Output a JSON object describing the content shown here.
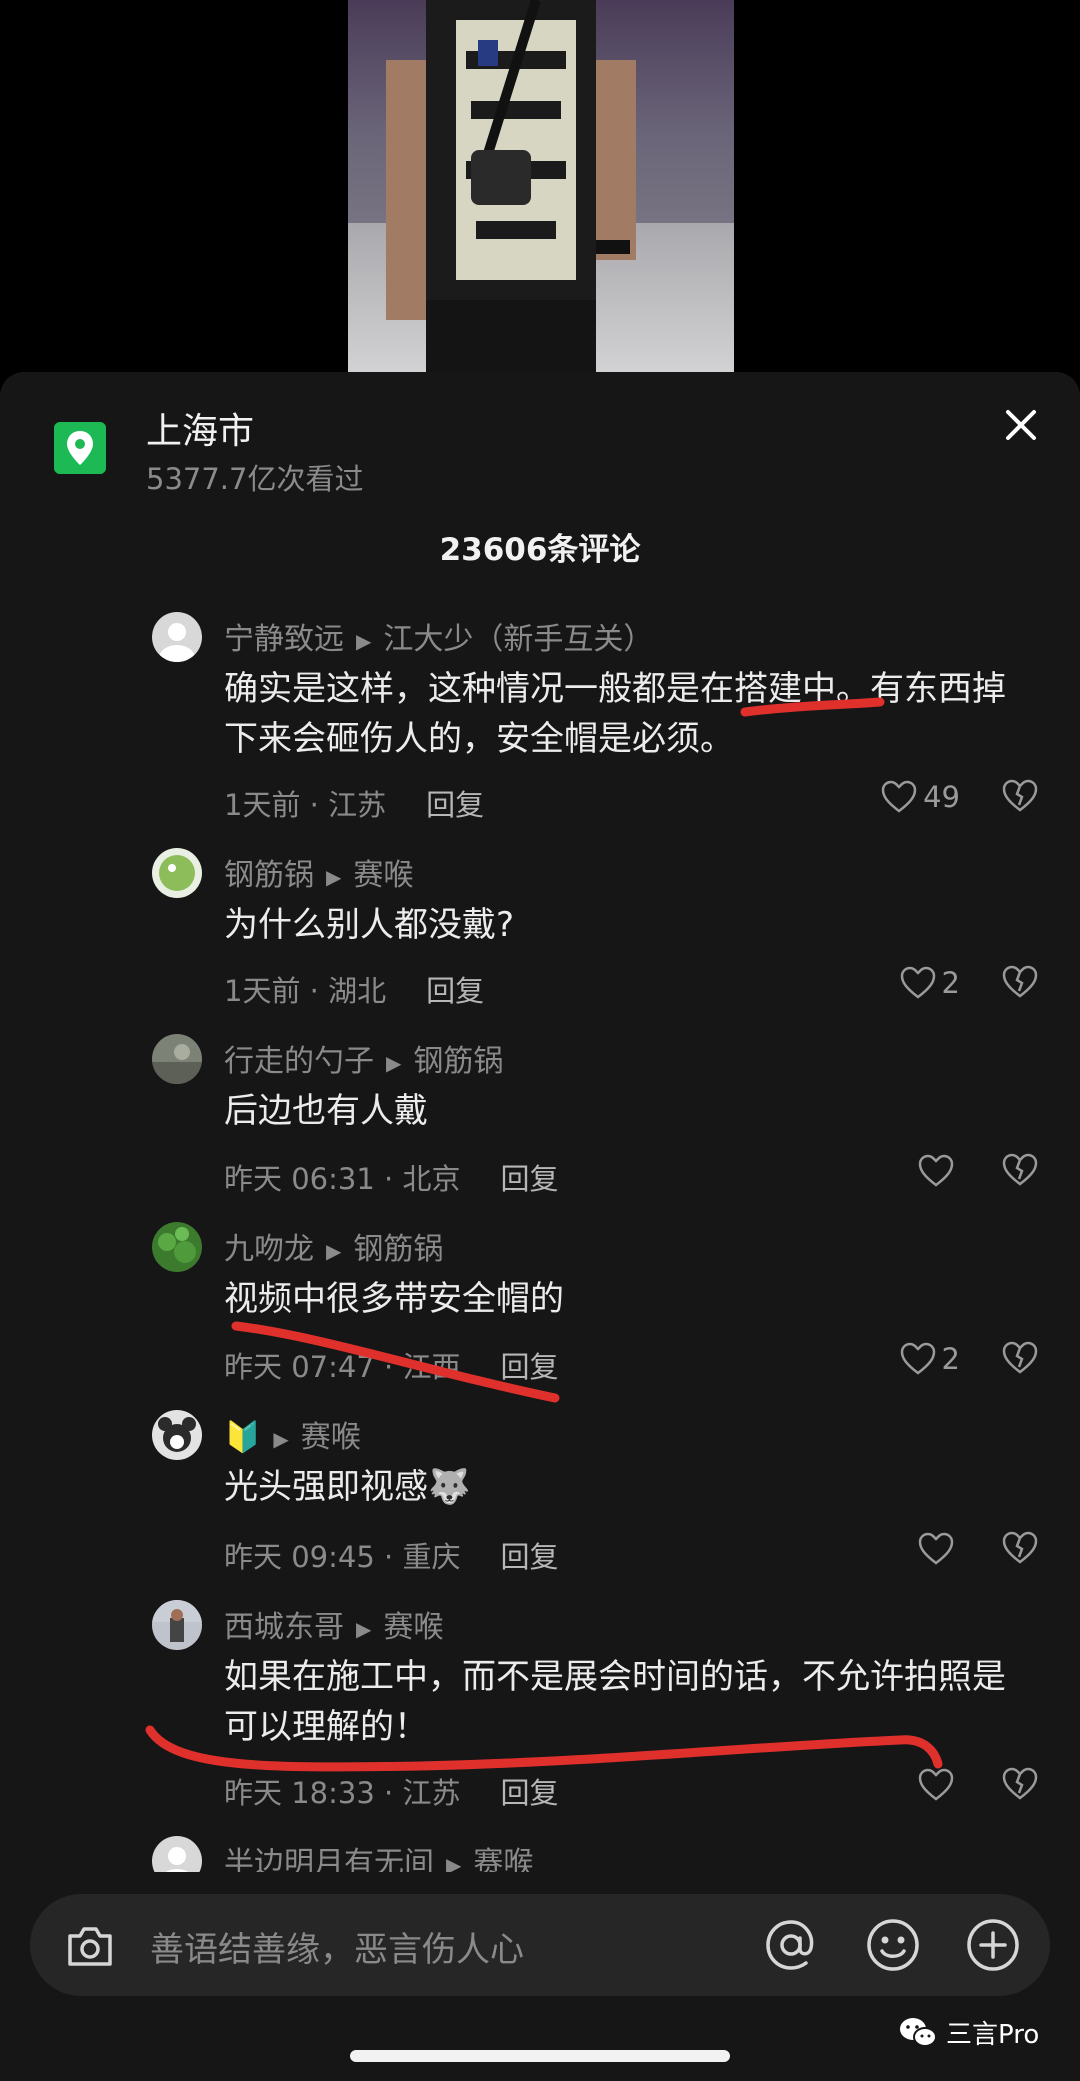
{
  "location": {
    "title": "上海市",
    "views": "5377.7亿次看过"
  },
  "comment_count": "23606条评论",
  "comments": [
    {
      "user": "宁静致远",
      "reply_to": "江大少（新手互关）",
      "text": "确实是这样，这种情况一般都是在搭建中。有东西掉下来会砸伤人的，安全帽是必须。",
      "time_loc": "1天前 · 江苏",
      "reply_label": "回复",
      "likes": "49"
    },
    {
      "user": "钢筋锅",
      "reply_to": "赛喉",
      "text": "为什么别人都没戴?",
      "time_loc": "1天前 · 湖北",
      "reply_label": "回复",
      "likes": "2"
    },
    {
      "user": "行走的勺子",
      "reply_to": "钢筋锅",
      "text": "后边也有人戴",
      "time_loc": "昨天 06:31 · 北京",
      "reply_label": "回复",
      "likes": ""
    },
    {
      "user": "九吻龙",
      "reply_to": "钢筋锅",
      "text": "视频中很多带安全帽的",
      "time_loc": "昨天 07:47 · 江西",
      "reply_label": "回复",
      "likes": "2"
    },
    {
      "user": "🔰",
      "reply_to": "赛喉",
      "text": "光头强即视感🐺",
      "time_loc": "昨天 09:45 · 重庆",
      "reply_label": "回复",
      "likes": ""
    },
    {
      "user": "西城东哥",
      "reply_to": "赛喉",
      "text": "如果在施工中，而不是展会时间的话，不允许拍照是可以理解的！",
      "time_loc": "昨天 18:33 · 江苏",
      "reply_label": "回复",
      "likes": ""
    },
    {
      "user": "半边明月有无间",
      "reply_to": "赛喉",
      "text": "",
      "time_loc": "",
      "reply_label": "",
      "likes": ""
    }
  ],
  "input": {
    "placeholder": "善语结善缘，恶言伤人心"
  },
  "watermark": "三言Pro",
  "colors": {
    "sheet_bg": "#161616",
    "location_icon": "#1db954",
    "annotation": "#e0302c"
  },
  "icons": [
    "location-pin-icon",
    "close-icon",
    "heart-icon",
    "dislike-heart-icon",
    "camera-icon",
    "at-icon",
    "emoji-icon",
    "plus-icon",
    "wechat-icon"
  ]
}
